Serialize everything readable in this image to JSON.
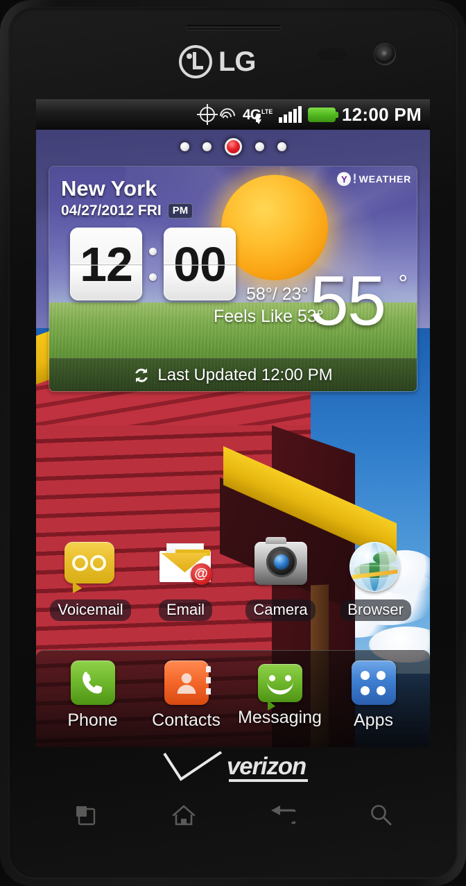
{
  "device": {
    "brand": "LG",
    "carrier": "verizon",
    "hardware": {
      "earpiece": "earpiece-speaker",
      "proximity_sensor": "proximity-sensor",
      "front_camera": "front-camera"
    }
  },
  "status_bar": {
    "time": "12:00 PM",
    "icons": [
      {
        "name": "gps-icon",
        "label": "GPS"
      },
      {
        "name": "wifi-icon",
        "label": "Wi-Fi"
      },
      {
        "name": "network-4g-lte-icon",
        "label": "4G LTE"
      },
      {
        "name": "data-arrows-icon",
        "label": "Data up/down"
      },
      {
        "name": "signal-bars-icon",
        "label": "Signal",
        "bars": 5
      },
      {
        "name": "battery-icon",
        "label": "Battery",
        "level": "full",
        "color": "#4fb51d"
      }
    ],
    "network_4g": "4G",
    "network_lte": "LTE"
  },
  "home_screen": {
    "page_indicator": {
      "total": 5,
      "active_index": 2
    },
    "wallpaper": "red-barn-blue-sky"
  },
  "weather_widget": {
    "provider": "WEATHER",
    "provider_mark": "Y",
    "provider_bang": "!",
    "city": "New York",
    "date": "04/27/2012 FRI",
    "ampm": "PM",
    "clock_hours": "12",
    "clock_minutes": "00",
    "high_low": "58°/ 23°",
    "feels_like": "Feels Like 53°",
    "current_temp": "55",
    "degree_symbol": "°",
    "last_updated": "Last Updated 12:00 PM",
    "refresh_icon": "refresh-icon"
  },
  "apps": [
    {
      "label": "Voicemail",
      "icon": "voicemail-icon"
    },
    {
      "label": "Email",
      "icon": "email-icon"
    },
    {
      "label": "Camera",
      "icon": "camera-icon"
    },
    {
      "label": "Browser",
      "icon": "browser-icon"
    }
  ],
  "dock": [
    {
      "label": "Phone",
      "icon": "phone-icon",
      "color": "#6fb82c"
    },
    {
      "label": "Contacts",
      "icon": "contacts-icon",
      "color": "#f4672a"
    },
    {
      "label": "Messaging",
      "icon": "messaging-icon",
      "color": "#6fb82c"
    },
    {
      "label": "Apps",
      "icon": "apps-grid-icon",
      "color": "#3f7fd1"
    }
  ],
  "nav_bar": [
    {
      "name": "menu-icon",
      "label": "Menu"
    },
    {
      "name": "home-icon",
      "label": "Home"
    },
    {
      "name": "back-icon",
      "label": "Back"
    },
    {
      "name": "search-icon",
      "label": "Search"
    }
  ],
  "branding": {
    "lg_text": "LG",
    "verizon_text": "verizon"
  },
  "colors": {
    "accent_red": "#e8202a",
    "battery_green": "#4fb51d",
    "barn_red": "#c0323f",
    "eave_yellow": "#f5c518",
    "sun_orange": "#ffbe2e"
  }
}
